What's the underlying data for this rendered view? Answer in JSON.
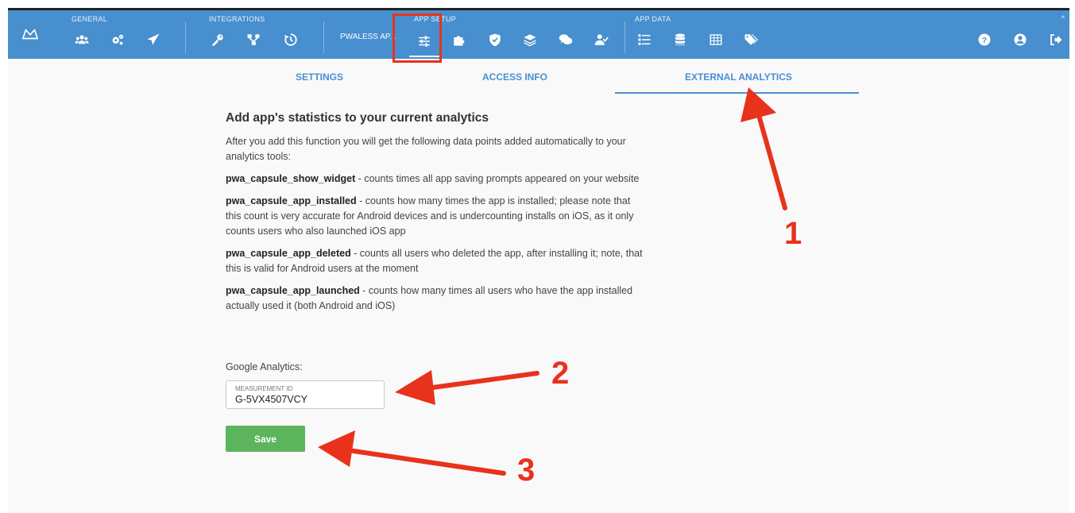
{
  "topbar": {
    "groups": {
      "general": "GENERAL",
      "integrations": "INTEGRATIONS",
      "app_setup": "APP SETUP",
      "app_data": "APP DATA"
    },
    "app_name": "PWALESS AP...",
    "icons": [
      "logo-icon",
      "users-icon",
      "gears-icon",
      "paper-plane-icon",
      "key-icon",
      "network-icon",
      "history-icon",
      "sliders-icon",
      "puzzle-icon",
      "shield-icon",
      "layers-icon",
      "comments-icon",
      "user-check-icon",
      "list-icon",
      "database-icon",
      "table-icon",
      "tags-icon",
      "help-icon",
      "user-circle-icon",
      "sign-out-icon"
    ],
    "bg_color": "#478fce"
  },
  "tabs": {
    "settings": "SETTINGS",
    "access_info": "ACCESS INFO",
    "external_analytics": "EXTERNAL ANALYTICS",
    "active": "EXTERNAL ANALYTICS"
  },
  "content": {
    "heading": "Add app's statistics to your current analytics",
    "intro": "After you add this function you will get the following data points added automatically to your analytics tools:",
    "points": [
      {
        "key": "pwa_capsule_show_widget",
        "desc": " - counts times all app saving prompts appeared on your website"
      },
      {
        "key": "pwa_capsule_app_installed",
        "desc": " - counts how many times the app is installed; please note that this count is very accurate for Android devices and is undercounting installs on iOS, as it only counts users who also launched iOS app"
      },
      {
        "key": "pwa_capsule_app_deleted",
        "desc": " - counts all users who deleted the app, after installing it; note, that this is valid for Android users at the moment"
      },
      {
        "key": "pwa_capsule_app_launched",
        "desc": " - counts how many times all users who have the app installed actually used it (both Android and iOS)"
      }
    ]
  },
  "form": {
    "ga_label": "Google Analytics:",
    "field_caption": "MEASUREMENT ID",
    "measurement_id": "G-5VX4507VCY",
    "save_label": "Save",
    "save_color": "#5cb55c"
  },
  "annotations": {
    "step1": "1",
    "step2": "2",
    "step3": "3",
    "color": "#e8321c"
  }
}
